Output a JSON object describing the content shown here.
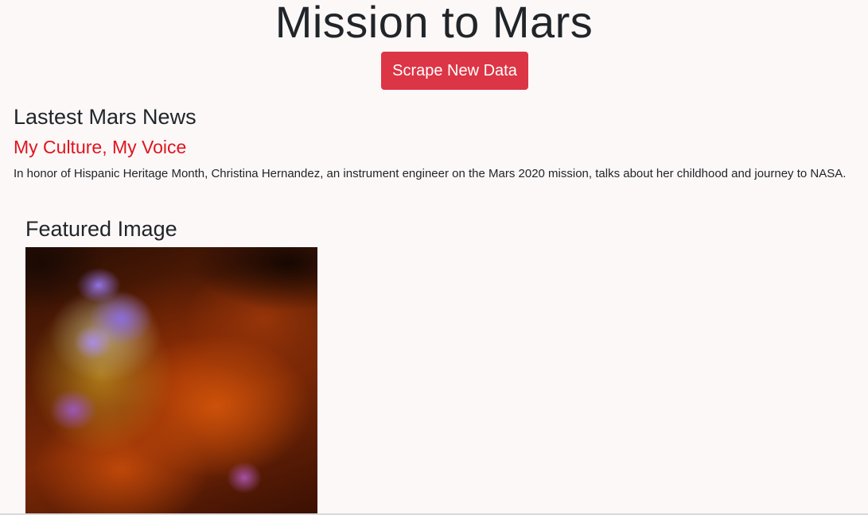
{
  "header": {
    "title": "Mission to Mars",
    "scrape_button_label": "Scrape New Data"
  },
  "news": {
    "heading": "Lastest Mars News",
    "title": "My Culture, My Voice",
    "paragraph": "In honor of Hispanic Heritage Month, Christina Hernandez, an instrument engineer on the Mars 2020 mission, talks about her childhood and journey to NASA."
  },
  "featured": {
    "heading": "Featured Image"
  },
  "colors": {
    "button": "#dc3545",
    "news_title": "#e0141e",
    "background": "#fdf8f8"
  }
}
